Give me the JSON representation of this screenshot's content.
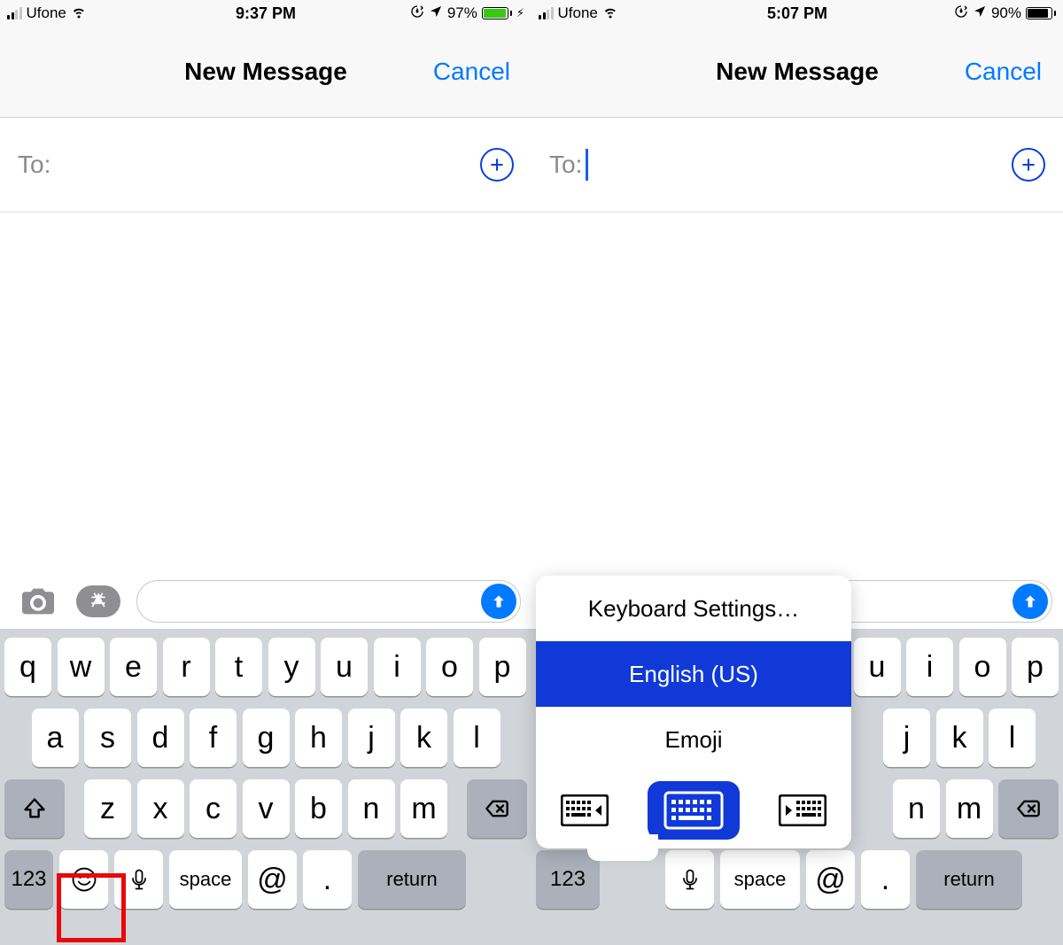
{
  "left": {
    "status": {
      "carrier": "Ufone",
      "time": "9:37 PM",
      "battery_pct": "97%",
      "battery_fill_color": "#3ac813",
      "battery_fill_width": "97%",
      "charging_glyph": "⚡︎"
    },
    "nav": {
      "title": "New Message",
      "cancel": "Cancel"
    },
    "to_label": "To:",
    "keyboard": {
      "row1": [
        "q",
        "w",
        "e",
        "r",
        "t",
        "y",
        "u",
        "i",
        "o",
        "p"
      ],
      "row2": [
        "a",
        "s",
        "d",
        "f",
        "g",
        "h",
        "j",
        "k",
        "l"
      ],
      "row3": [
        "z",
        "x",
        "c",
        "v",
        "b",
        "n",
        "m"
      ],
      "numKey": "123",
      "space": "space",
      "at": "@",
      "dot": ".",
      "ret": "return"
    }
  },
  "right": {
    "status": {
      "carrier": "Ufone",
      "time": "5:07 PM",
      "battery_pct": "90%",
      "battery_fill_color": "#000",
      "battery_fill_width": "90%"
    },
    "nav": {
      "title": "New Message",
      "cancel": "Cancel"
    },
    "to_label": "To:",
    "popup": {
      "settings": "Keyboard Settings…",
      "english": "English (US)",
      "emoji": "Emoji"
    },
    "keyboard": {
      "row1_partial": [
        "u",
        "i",
        "o",
        "p"
      ],
      "row2_partial": [
        "j",
        "k",
        "l"
      ],
      "row3_partial": [
        "n",
        "m"
      ],
      "numKey": "123",
      "space": "space",
      "at": "@",
      "dot": ".",
      "ret": "return"
    }
  }
}
